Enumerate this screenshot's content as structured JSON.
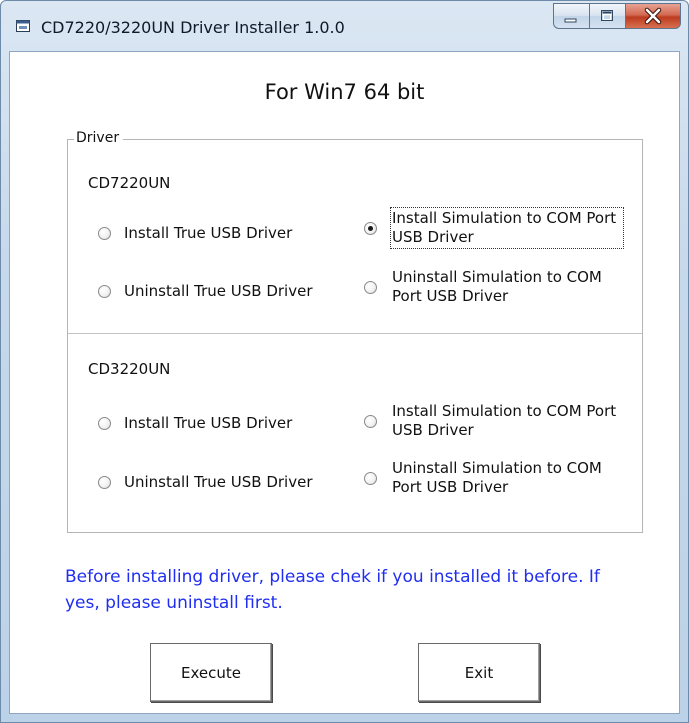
{
  "window": {
    "title": "CD7220/3220UN Driver Installer 1.0.0"
  },
  "subtitle": "For Win7 64 bit",
  "driver_group": {
    "legend": "Driver",
    "devices": [
      {
        "name": "CD7220UN",
        "options": [
          {
            "label": "Install True USB Driver",
            "checked": false
          },
          {
            "label": "Install Simulation to COM Port USB Driver",
            "checked": true
          },
          {
            "label": "Uninstall True USB Driver",
            "checked": false
          },
          {
            "label": "Uninstall Simulation to COM Port USB Driver",
            "checked": false
          }
        ]
      },
      {
        "name": "CD3220UN",
        "options": [
          {
            "label": "Install True USB Driver",
            "checked": false
          },
          {
            "label": "Install Simulation to COM Port USB Driver",
            "checked": false
          },
          {
            "label": "Uninstall True USB Driver",
            "checked": false
          },
          {
            "label": "Uninstall Simulation to COM Port USB Driver",
            "checked": false
          }
        ]
      }
    ]
  },
  "note": "Before installing driver, please chek if you installed it before. If yes, please uninstall first.",
  "buttons": {
    "execute": "Execute",
    "exit": "Exit"
  },
  "colors": {
    "note_text": "#1f2ef0",
    "close_button": "#c8472a"
  },
  "icons": {
    "app": "window-app-icon",
    "minimize": "minimize-icon",
    "maximize": "maximize-icon",
    "close": "close-icon"
  }
}
